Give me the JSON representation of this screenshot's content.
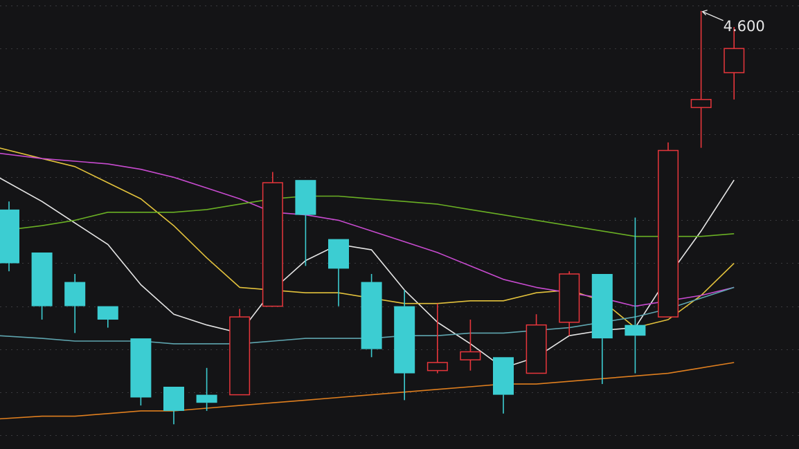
{
  "chart_data": {
    "type": "candlestick",
    "title": "",
    "xlabel": "",
    "ylabel": "",
    "ylim": [
      3.12,
      4.62
    ],
    "grid": true,
    "colors": {
      "background": "#141416",
      "up": "#e8363c",
      "down": "#3ccdd2",
      "grid": "#3a3a3e"
    },
    "candles": [
      {
        "open": 3.86,
        "close": 3.66,
        "high": 3.89,
        "low": 3.63
      },
      {
        "open": 3.7,
        "close": 3.5,
        "high": 3.7,
        "low": 3.45
      },
      {
        "open": 3.59,
        "close": 3.5,
        "high": 3.62,
        "low": 3.4
      },
      {
        "open": 3.5,
        "close": 3.45,
        "high": 3.5,
        "low": 3.42
      },
      {
        "open": 3.38,
        "close": 3.16,
        "high": 3.38,
        "low": 3.13
      },
      {
        "open": 3.2,
        "close": 3.11,
        "high": 3.2,
        "low": 3.06
      },
      {
        "open": 3.17,
        "close": 3.14,
        "high": 3.27,
        "low": 3.11
      },
      {
        "open": 3.17,
        "close": 3.46,
        "high": 3.49,
        "low": 3.17
      },
      {
        "open": 3.5,
        "close": 3.96,
        "high": 4.0,
        "low": 3.5
      },
      {
        "open": 3.97,
        "close": 3.84,
        "high": 3.97,
        "low": 3.65
      },
      {
        "open": 3.75,
        "close": 3.64,
        "high": 3.75,
        "low": 3.5
      },
      {
        "open": 3.59,
        "close": 3.34,
        "high": 3.62,
        "low": 3.31
      },
      {
        "open": 3.5,
        "close": 3.25,
        "high": 3.56,
        "low": 3.15
      },
      {
        "open": 3.26,
        "close": 3.29,
        "high": 3.51,
        "low": 3.25
      },
      {
        "open": 3.3,
        "close": 3.33,
        "high": 3.45,
        "low": 3.26
      },
      {
        "open": 3.31,
        "close": 3.17,
        "high": 3.31,
        "low": 3.1
      },
      {
        "open": 3.25,
        "close": 3.43,
        "high": 3.47,
        "low": 3.25
      },
      {
        "open": 3.44,
        "close": 3.62,
        "high": 3.63,
        "low": 3.39
      },
      {
        "open": 3.62,
        "close": 3.38,
        "high": 3.62,
        "low": 3.21
      },
      {
        "open": 3.43,
        "close": 3.39,
        "high": 3.83,
        "low": 3.25
      },
      {
        "open": 3.46,
        "close": 4.08,
        "high": 4.11,
        "low": 3.46
      },
      {
        "open": 4.24,
        "close": 4.27,
        "high": 4.6,
        "low": 4.09
      },
      {
        "open": 4.37,
        "close": 4.46,
        "high": 4.54,
        "low": 4.27
      }
    ],
    "moving_averages": [
      {
        "color": "#e6e6e6",
        "values": [
          3.98,
          3.89,
          3.81,
          3.73,
          3.58,
          3.47,
          3.43,
          3.4,
          3.56,
          3.67,
          3.73,
          3.71,
          3.56,
          3.44,
          3.36,
          3.27,
          3.31,
          3.39,
          3.41,
          3.42,
          3.61,
          3.78,
          3.97
        ]
      },
      {
        "color": "#e3c23c",
        "values": [
          4.09,
          4.05,
          4.02,
          3.96,
          3.9,
          3.8,
          3.68,
          3.57,
          3.56,
          3.55,
          3.55,
          3.53,
          3.51,
          3.51,
          3.52,
          3.52,
          3.55,
          3.56,
          3.52,
          3.42,
          3.45,
          3.54,
          3.66
        ]
      },
      {
        "color": "#c84bd0",
        "values": [
          4.07,
          4.05,
          4.04,
          4.03,
          4.01,
          3.98,
          3.94,
          3.9,
          3.85,
          3.84,
          3.82,
          3.78,
          3.74,
          3.7,
          3.65,
          3.6,
          3.57,
          3.55,
          3.53,
          3.5,
          3.52,
          3.54,
          3.57
        ]
      },
      {
        "color": "#6ab024",
        "values": [
          3.78,
          3.8,
          3.82,
          3.85,
          3.85,
          3.85,
          3.86,
          3.88,
          3.9,
          3.91,
          3.91,
          3.9,
          3.89,
          3.88,
          3.86,
          3.84,
          3.82,
          3.8,
          3.78,
          3.76,
          3.76,
          3.76,
          3.77
        ]
      },
      {
        "color": "#5fa6b0",
        "values": [
          3.39,
          3.38,
          3.37,
          3.37,
          3.37,
          3.36,
          3.36,
          3.36,
          3.37,
          3.38,
          3.38,
          3.38,
          3.39,
          3.39,
          3.4,
          3.4,
          3.41,
          3.42,
          3.44,
          3.46,
          3.49,
          3.53,
          3.57
        ]
      },
      {
        "color": "#e07f1f",
        "values": [
          3.08,
          3.09,
          3.09,
          3.1,
          3.11,
          3.11,
          3.12,
          3.13,
          3.14,
          3.15,
          3.16,
          3.17,
          3.18,
          3.19,
          3.2,
          3.21,
          3.21,
          3.22,
          3.23,
          3.24,
          3.25,
          3.27,
          3.29
        ]
      }
    ],
    "gridlines": [
      4.62,
      4.46,
      4.3,
      4.14,
      3.98,
      3.82,
      3.66,
      3.5,
      3.34,
      3.18,
      3.02
    ],
    "annotations": [
      {
        "text": "4.600",
        "value": 4.6,
        "candle_index": 21
      }
    ]
  }
}
